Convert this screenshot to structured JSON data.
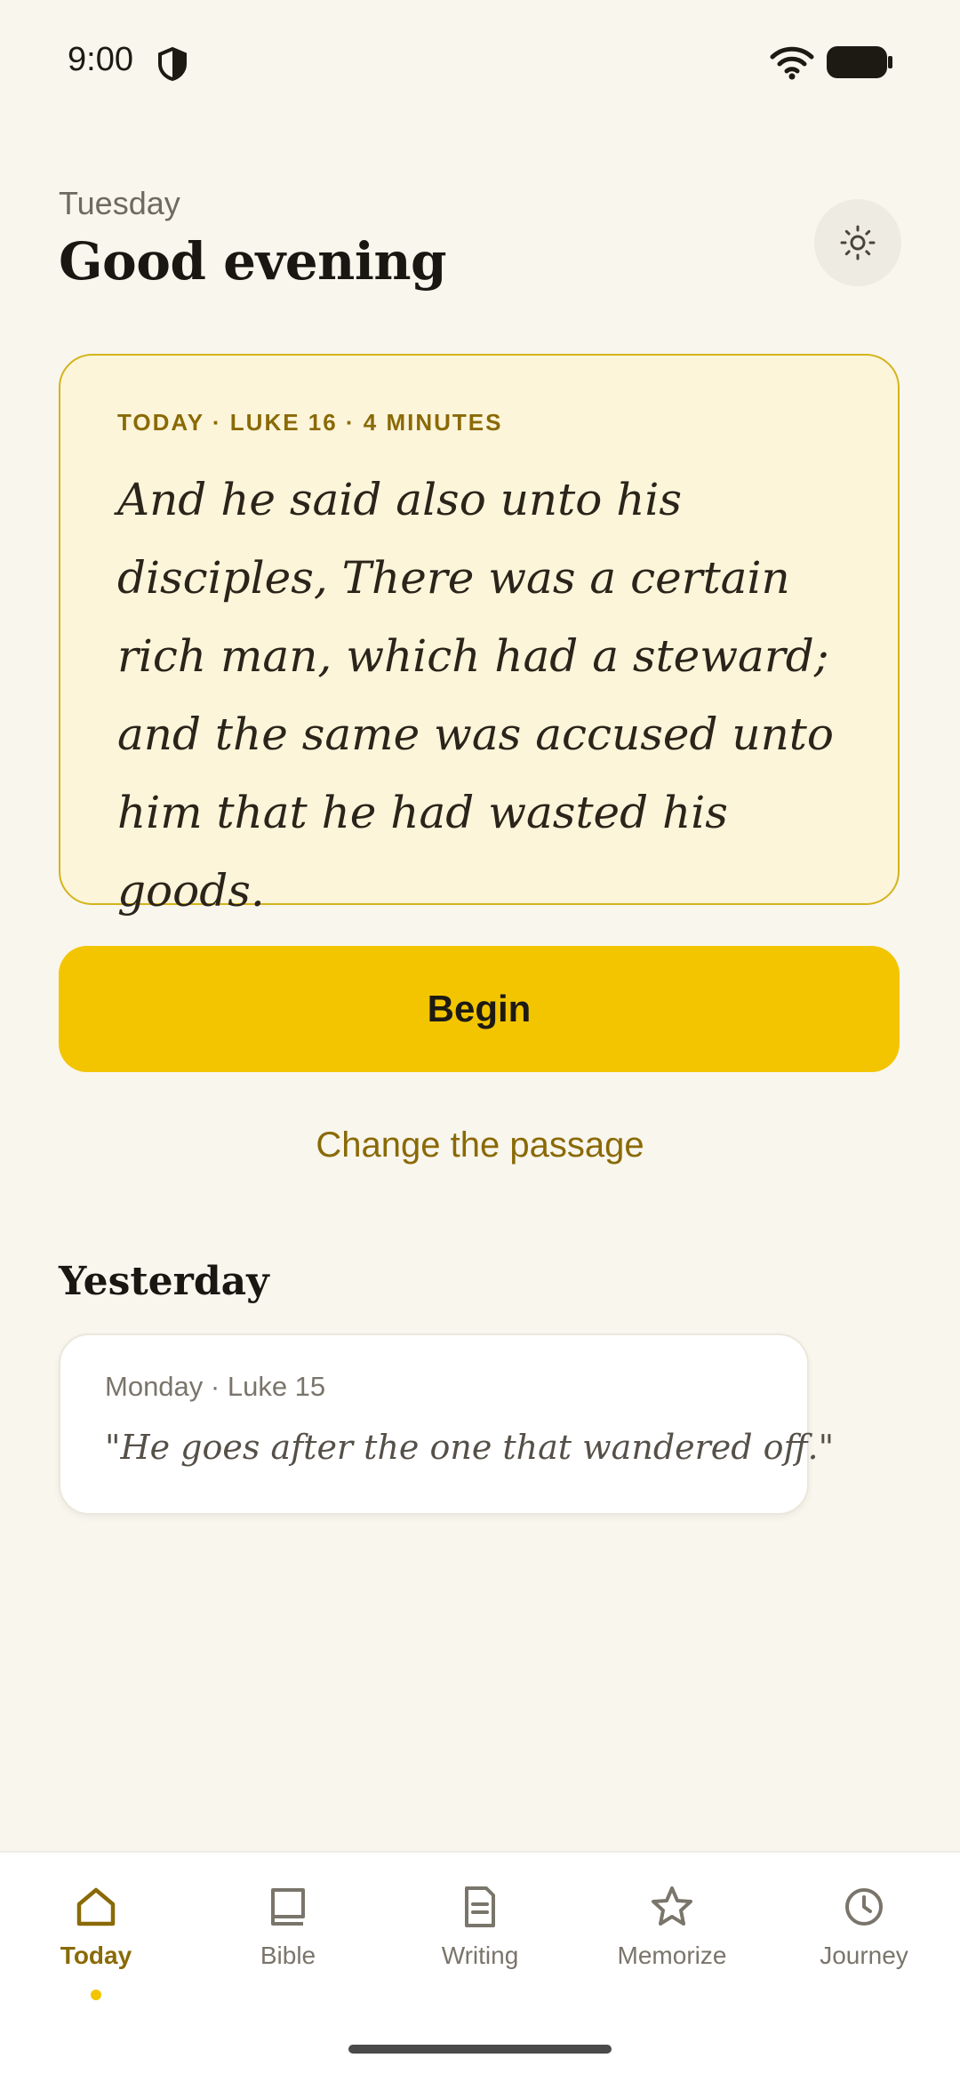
{
  "status_bar": {
    "time": "9:00",
    "icons": [
      "shield-icon",
      "wifi-icon",
      "battery-icon"
    ]
  },
  "header": {
    "day": "Tuesday",
    "greeting": "Good evening",
    "theme_icon": "sun-icon"
  },
  "passage": {
    "meta": "TODAY · LUKE 16 · 4 MINUTES",
    "text": "And he said also unto his disciples, There was a certain rich man, which had a steward; and the same was accused unto him that he had wasted his goods."
  },
  "actions": {
    "begin_label": "Begin",
    "change_label": "Change the passage"
  },
  "yesterday": {
    "title": "Yesterday",
    "meta": "Monday · Luke 15",
    "quote": "\"He goes after the one that wandered off.\""
  },
  "nav": {
    "items": [
      {
        "label": "Today",
        "icon": "home-icon",
        "active": true
      },
      {
        "label": "Bible",
        "icon": "book-icon",
        "active": false
      },
      {
        "label": "Writing",
        "icon": "document-icon",
        "active": false
      },
      {
        "label": "Memorize",
        "icon": "star-icon",
        "active": false
      },
      {
        "label": "Journey",
        "icon": "clock-icon",
        "active": false
      }
    ]
  },
  "colors": {
    "accent": "#f3c500",
    "accent_text": "#8a6a06",
    "background": "#f9f6ee",
    "card": "#fdf5da"
  }
}
